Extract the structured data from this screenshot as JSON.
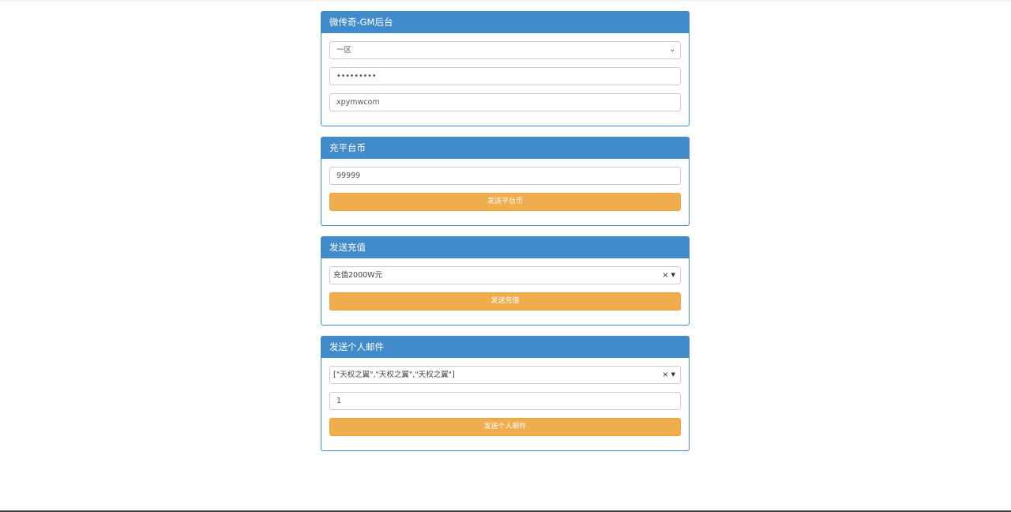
{
  "login_panel": {
    "title": "微传奇-GM后台",
    "server_select": {
      "selected": "一区"
    },
    "password_field": {
      "value": "•••••••••"
    },
    "account_field": {
      "value": "xpymwcom"
    }
  },
  "platform_currency_panel": {
    "title": "充平台币",
    "amount_field": {
      "value": "99999"
    },
    "send_button": "发送平台币"
  },
  "recharge_panel": {
    "title": "发送充值",
    "recharge_select": {
      "selected": "充值2000W元"
    },
    "send_button": "发送充值"
  },
  "mail_panel": {
    "title": "发送个人邮件",
    "item_select": {
      "selected": "[\"天权之翼\",\"天权之翼\",\"天权之翼\"]"
    },
    "quantity_field": {
      "value": "1"
    },
    "send_button": "发送个人邮件"
  },
  "icons": {
    "select_arrow": "chevron-down-icon",
    "clear": "close-icon",
    "dropdown": "caret-down-icon"
  },
  "colors": {
    "panel_primary": "#428bca",
    "button_warning": "#f0ad4e"
  }
}
